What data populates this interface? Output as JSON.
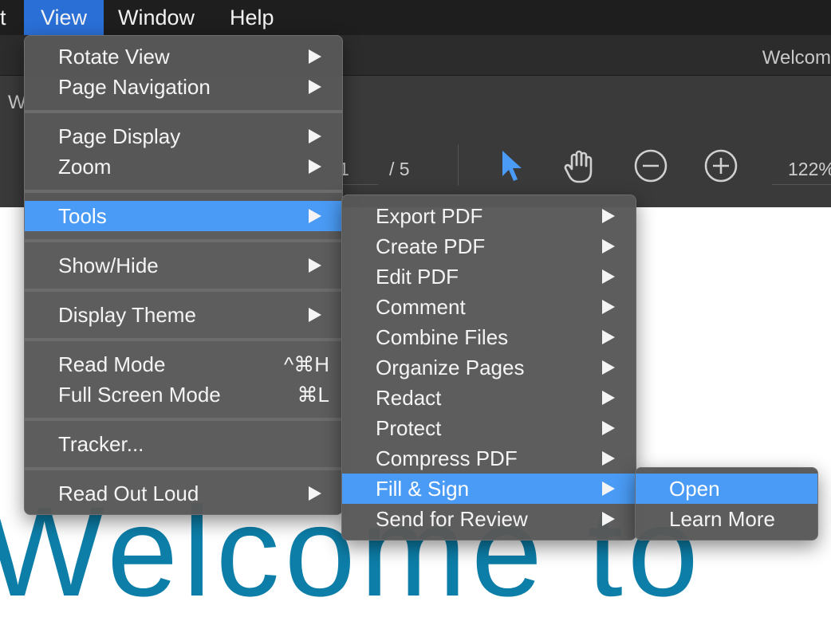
{
  "menubar": {
    "items": [
      {
        "label": "t"
      },
      {
        "label": "View"
      },
      {
        "label": "Window"
      },
      {
        "label": "Help"
      }
    ]
  },
  "window": {
    "title": "Welcom",
    "tab_fragment": "W",
    "page_current": "1",
    "page_total": "/ 5",
    "zoom": "122%",
    "background_text": "Welcome to"
  },
  "view_menu": {
    "items": [
      {
        "label": "Rotate View"
      },
      {
        "label": "Page Navigation"
      },
      {
        "label": "Page Display"
      },
      {
        "label": "Zoom"
      },
      {
        "label": "Tools"
      },
      {
        "label": "Show/Hide"
      },
      {
        "label": "Display Theme"
      },
      {
        "label": "Read Mode",
        "shortcut": "^⌘H"
      },
      {
        "label": "Full Screen Mode",
        "shortcut": "⌘L"
      },
      {
        "label": "Tracker..."
      },
      {
        "label": "Read Out Loud"
      }
    ]
  },
  "tools_menu": {
    "items": [
      {
        "label": "Export PDF"
      },
      {
        "label": "Create PDF"
      },
      {
        "label": "Edit PDF"
      },
      {
        "label": "Comment"
      },
      {
        "label": "Combine Files"
      },
      {
        "label": "Organize Pages"
      },
      {
        "label": "Redact"
      },
      {
        "label": "Protect"
      },
      {
        "label": "Compress PDF"
      },
      {
        "label": "Fill & Sign"
      },
      {
        "label": "Send for Review"
      }
    ]
  },
  "fill_sign_menu": {
    "items": [
      {
        "label": "Open"
      },
      {
        "label": "Learn More"
      }
    ]
  },
  "colors": {
    "highlight": "#4a9bf5",
    "menubar_active": "#2a6fd6",
    "pointer_tool": "#4a9bf5"
  },
  "icons": [
    "select-pointer-icon",
    "hand-tool-icon",
    "zoom-out-icon",
    "zoom-in-icon",
    "submenu-arrow-icon"
  ]
}
